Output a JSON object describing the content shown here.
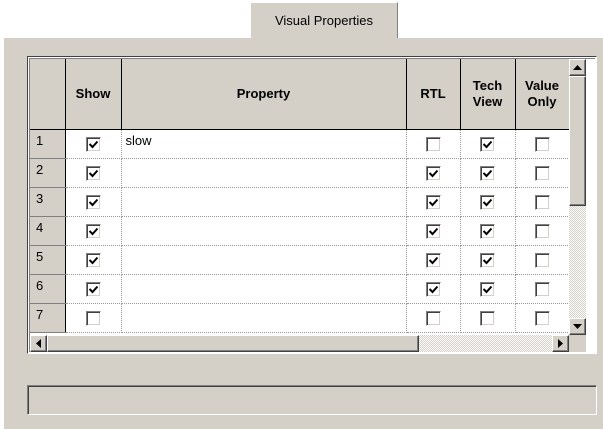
{
  "tab": {
    "label": "Visual Properties"
  },
  "grid": {
    "columns": [
      "",
      "Show",
      "Property",
      "RTL",
      "Tech View",
      "Value Only"
    ],
    "rows": [
      {
        "num": "1",
        "show": true,
        "property": "slow",
        "rtl": false,
        "tech_view": true,
        "value_only": false
      },
      {
        "num": "2",
        "show": true,
        "property": "",
        "rtl": true,
        "tech_view": true,
        "value_only": false
      },
      {
        "num": "3",
        "show": true,
        "property": "",
        "rtl": true,
        "tech_view": true,
        "value_only": false
      },
      {
        "num": "4",
        "show": true,
        "property": "",
        "rtl": true,
        "tech_view": true,
        "value_only": false
      },
      {
        "num": "5",
        "show": true,
        "property": "",
        "rtl": true,
        "tech_view": true,
        "value_only": false
      },
      {
        "num": "6",
        "show": true,
        "property": "",
        "rtl": true,
        "tech_view": true,
        "value_only": false
      },
      {
        "num": "7",
        "show": false,
        "property": "",
        "rtl": false,
        "tech_view": false,
        "value_only": false
      }
    ]
  },
  "status": {
    "text": ""
  },
  "colors": {
    "face": "#d4d0c8",
    "shadow": "#808080",
    "dark": "#404040",
    "highlight": "#ffffff"
  }
}
